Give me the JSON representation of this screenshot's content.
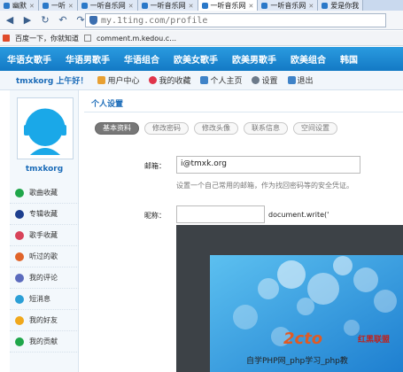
{
  "browser": {
    "tabs": [
      {
        "label": "幽默"
      },
      {
        "label": "一听"
      },
      {
        "label": "一听音乐网"
      },
      {
        "label": "一听音乐网"
      },
      {
        "label": "一听音乐网",
        "active": true
      },
      {
        "label": "一听音乐网"
      },
      {
        "label": "爱是你我"
      }
    ],
    "url": "my.1ting.com/profile",
    "favorites": [
      "百度一下，你就知道",
      "comment.m.kedou.c…"
    ]
  },
  "categories": [
    "华语女歌手",
    "华语男歌手",
    "华语组合",
    "欧美女歌手",
    "欧美男歌手",
    "欧美组合",
    "韩国"
  ],
  "userbar": {
    "greeting": "tmxkorg 上午好！",
    "links": [
      "用户中心",
      "我的收藏",
      "个人主页",
      "设置",
      "退出"
    ]
  },
  "sidebar": {
    "username": "tmxkorg",
    "menu": [
      {
        "label": "歌曲收藏",
        "icon": "music-note-icon",
        "color": "#1fa64a"
      },
      {
        "label": "专辑收藏",
        "icon": "disc-icon",
        "color": "#1d3f8f"
      },
      {
        "label": "歌手收藏",
        "icon": "singer-icon",
        "color": "#d8435a"
      },
      {
        "label": "听过的歌",
        "icon": "play-icon",
        "color": "#e0642a"
      },
      {
        "label": "我的评论",
        "icon": "comment-icon",
        "color": "#5b6bbd"
      },
      {
        "label": "短消息",
        "icon": "mail-icon",
        "color": "#2b9fd6"
      },
      {
        "label": "我的好友",
        "icon": "friend-icon",
        "color": "#f0a81c"
      },
      {
        "label": "我的贡献",
        "icon": "music-note-icon",
        "color": "#1fa64a"
      }
    ]
  },
  "main": {
    "section_title": "个人设置",
    "subtabs": [
      "基本资料",
      "修改密码",
      "修改头像",
      "联系信息",
      "空间设置"
    ],
    "email_label": "邮箱：",
    "email_value": "i@tmxk.org",
    "email_hint": "设置一个自己常用的邮箱，作为找回密码等的安全凭证。",
    "nickname_label": "昵称：",
    "nickname_value": "",
    "script_text": "document.write('"
  },
  "watermark": {
    "logo": "2cto",
    "brand": "红黑联盟",
    "text": "自学PHP网_php学习_php教"
  },
  "colors": {
    "accent": "#1a6bb8",
    "nav": "#1a87d3"
  }
}
